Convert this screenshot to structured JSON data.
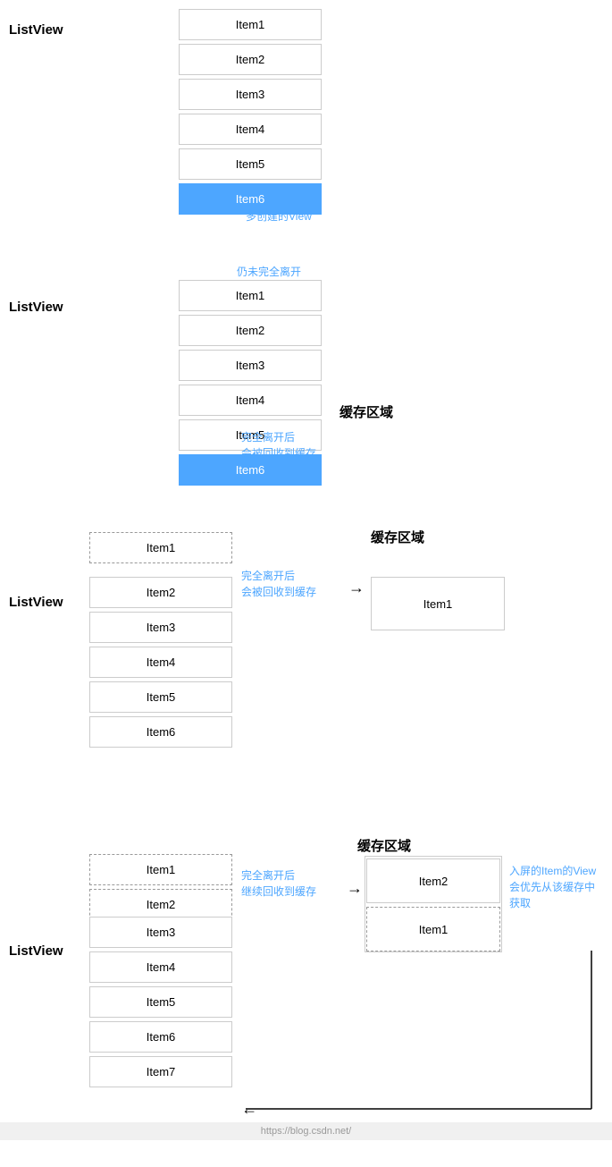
{
  "sections": [
    {
      "id": "section1",
      "listview_label": "ListView",
      "items": [
        {
          "text": "Item1",
          "style": "normal"
        },
        {
          "text": "Item2",
          "style": "normal"
        },
        {
          "text": "Item3",
          "style": "normal"
        },
        {
          "text": "Item4",
          "style": "normal"
        },
        {
          "text": "Item5",
          "style": "normal"
        },
        {
          "text": "Item6",
          "style": "highlighted"
        }
      ],
      "annotation": "多创建的View",
      "annotation_pos": "right_of_item6"
    },
    {
      "id": "section2",
      "listview_label": "ListView",
      "items": [
        {
          "text": "Item1",
          "style": "normal"
        },
        {
          "text": "Item2",
          "style": "normal"
        },
        {
          "text": "Item3",
          "style": "normal"
        },
        {
          "text": "Item4",
          "style": "normal"
        },
        {
          "text": "Item5",
          "style": "normal"
        },
        {
          "text": "Item6",
          "style": "highlighted"
        }
      ],
      "annotation_top": "仍未完全离开",
      "cache_label": "缓存区域",
      "annotation_cache": "完全离开后\n会被回收到缓存"
    },
    {
      "id": "section3",
      "listview_label": "ListView",
      "items_dashed": [
        {
          "text": "Item1",
          "style": "dashed"
        }
      ],
      "items": [
        {
          "text": "Item2",
          "style": "normal"
        },
        {
          "text": "Item3",
          "style": "normal"
        },
        {
          "text": "Item4",
          "style": "normal"
        },
        {
          "text": "Item5",
          "style": "normal"
        },
        {
          "text": "Item6",
          "style": "normal"
        }
      ],
      "annotation_cache": "完全离开后\n会被回收到缓存",
      "cache_label": "缓存区域",
      "cache_items": [
        {
          "text": "Item1",
          "style": "normal"
        }
      ]
    },
    {
      "id": "section4",
      "listview_label": "ListView",
      "items_dashed": [
        {
          "text": "Item1",
          "style": "dashed"
        },
        {
          "text": "Item2",
          "style": "dashed"
        }
      ],
      "items": [
        {
          "text": "Item3",
          "style": "normal"
        },
        {
          "text": "Item4",
          "style": "normal"
        },
        {
          "text": "Item5",
          "style": "normal"
        },
        {
          "text": "Item6",
          "style": "normal"
        },
        {
          "text": "Item7",
          "style": "normal"
        }
      ],
      "annotation_cache": "完全离开后\n继续回收到缓存",
      "cache_label": "缓存区域",
      "cache_items": [
        {
          "text": "Item2",
          "style": "normal"
        },
        {
          "text": "Item1",
          "style": "dashed"
        }
      ],
      "annotation_right": "入屏的Item的View\n会优先从该缓存中\n获取"
    }
  ]
}
